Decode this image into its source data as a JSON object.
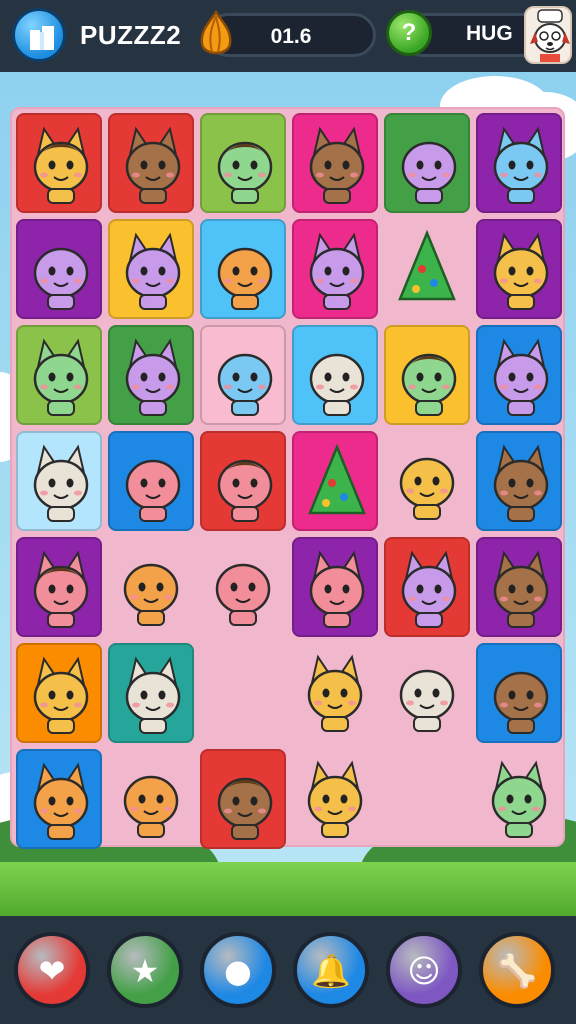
{
  "header": {
    "app_title": "PUZZZ2",
    "score_value": "01.6",
    "hint_label": "HUG"
  },
  "icons": {
    "home": "home-icon",
    "score": "onion-bulb-icon",
    "hint": "question-mark-icon",
    "avatar": "dog-chef-avatar"
  },
  "board": {
    "rows": [
      [
        {
          "character": "brown-haired-cat-boy",
          "bg": "#e53935"
        },
        {
          "character": "bear-with-bowler-hat",
          "bg": "#e53935"
        },
        {
          "character": "white-haired-girl",
          "bg": "#8bc34a"
        },
        {
          "character": "blue-cat",
          "bg": "#ec2b8c"
        },
        {
          "character": "red-green-ball",
          "bg": "#43a047"
        },
        {
          "character": "orange-haired-cat",
          "bg": "#8e24aa"
        }
      ],
      [
        {
          "character": "orange-balloon-fish",
          "bg": "#8e24aa"
        },
        {
          "character": "purple-cat",
          "bg": "#fbc02d"
        },
        {
          "character": "red-robot",
          "bg": "#4fc3f7"
        },
        {
          "character": "brown-dog",
          "bg": "#ec2b8c"
        },
        {
          "character": "christmas-tree",
          "bg": "none"
        },
        {
          "character": "orange-fox",
          "bg": "#8e24aa"
        }
      ],
      [
        {
          "character": "brown-cow",
          "bg": "#8bc34a"
        },
        {
          "character": "teal-cat",
          "bg": "#43a047"
        },
        {
          "character": "blue-fish-ball",
          "bg": "#f8bbd0"
        },
        {
          "character": "red-green-ball-creature",
          "bg": "#4fc3f7"
        },
        {
          "character": "boy-with-cap",
          "bg": "#fbc02d"
        },
        {
          "character": "yellow-cat",
          "bg": "#1e88e5"
        }
      ],
      [
        {
          "character": "pink-cat",
          "bg": "#b3e5fc"
        },
        {
          "character": "yellow-bird",
          "bg": "#1e88e5"
        },
        {
          "character": "boy-brown-hair",
          "bg": "#e53935"
        },
        {
          "character": "christmas-tree-snake",
          "bg": "#ec2b8c"
        },
        {
          "character": "blue-balloon-creature",
          "bg": "none"
        },
        {
          "character": "monkey",
          "bg": "#1e88e5"
        }
      ],
      [
        {
          "character": "brown-cat-girl",
          "bg": "#8e24aa"
        },
        {
          "character": "blue-whale",
          "bg": "none"
        },
        {
          "character": "yellow-lemon-creature",
          "bg": "none"
        },
        {
          "character": "blue-cat-with-crown",
          "bg": "#8e24aa"
        },
        {
          "character": "pink-blob-cat",
          "bg": "#e53935"
        },
        {
          "character": "yellow-pirate-cat",
          "bg": "#8e24aa"
        }
      ],
      [
        {
          "character": "calico-cat",
          "bg": "#fb8c00"
        },
        {
          "character": "white-chef-bear",
          "bg": "#26a69a"
        },
        {
          "character": "empty",
          "bg": "none"
        },
        {
          "character": "brown-squirrel",
          "bg": "none"
        },
        {
          "character": "mint-frog",
          "bg": "none"
        },
        {
          "character": "red-octopus",
          "bg": "#1e88e5"
        }
      ],
      [
        {
          "character": "yellow-cat-sad",
          "bg": "#1e88e5"
        },
        {
          "character": "blue-bird-blob",
          "bg": "none"
        },
        {
          "character": "boy-green-shirt",
          "bg": "#e53935"
        },
        {
          "character": "brown-chipmunk",
          "bg": "none"
        },
        {
          "character": "empty",
          "bg": "none"
        },
        {
          "character": "green-cat",
          "bg": "none"
        }
      ]
    ]
  },
  "powerups": [
    {
      "name": "heart-bomb-powerup",
      "color": "#e53935"
    },
    {
      "name": "star-powerup",
      "color": "#43a047"
    },
    {
      "name": "bomb-timer-powerup",
      "color": "#1e88e5"
    },
    {
      "name": "bell-powerup",
      "color": "#1e88e5"
    },
    {
      "name": "gear-smiley-powerup",
      "color": "#7e57c2"
    },
    {
      "name": "bone-powerup",
      "color": "#fb8c00"
    }
  ]
}
